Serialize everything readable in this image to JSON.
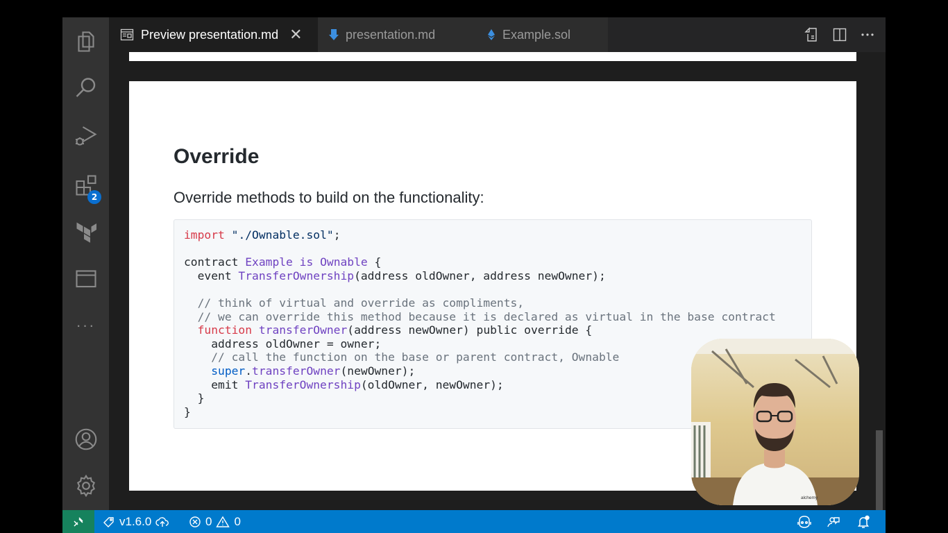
{
  "colors": {
    "activity_bar": "#333333",
    "editor_bg": "#1e1e1e",
    "status_bar": "#007acc",
    "remote_indicator": "#16825d",
    "badge": "#0a6fd0"
  },
  "activity_bar": {
    "items": [
      {
        "icon": "files-icon"
      },
      {
        "icon": "search-icon"
      },
      {
        "icon": "run-debug-icon"
      },
      {
        "icon": "extensions-icon",
        "badge": "2"
      },
      {
        "icon": "terraform-icon"
      },
      {
        "icon": "panel-icon"
      },
      {
        "icon": "more-icon",
        "label": "···"
      },
      {
        "icon": "account-icon"
      },
      {
        "icon": "gear-icon"
      }
    ]
  },
  "tabs": [
    {
      "label": "Preview presentation.md",
      "icon": "preview-icon",
      "active": true,
      "close": "✕"
    },
    {
      "label": "presentation.md",
      "icon": "markdown-icon",
      "active": false
    },
    {
      "label": "Example.sol",
      "icon": "solidity-icon",
      "active": false
    }
  ],
  "tab_actions": [
    "open-source-icon",
    "split-editor-icon",
    "more-actions-icon"
  ],
  "slide": {
    "heading": "Override",
    "text": "Override methods to build on the functionality:",
    "code": [
      [
        {
          "t": "import",
          "c": "kw"
        },
        {
          "t": " "
        },
        {
          "t": "\"./Ownable.sol\"",
          "c": "str"
        },
        {
          "t": ";"
        }
      ],
      [
        {
          "t": ""
        }
      ],
      [
        {
          "t": "contract "
        },
        {
          "t": "Example",
          "c": "ent"
        },
        {
          "t": " "
        },
        {
          "t": "is",
          "c": "ent"
        },
        {
          "t": " "
        },
        {
          "t": "Ownable",
          "c": "ent"
        },
        {
          "t": " {"
        }
      ],
      [
        {
          "t": "  event "
        },
        {
          "t": "TransferOwnership",
          "c": "ent"
        },
        {
          "t": "(address oldOwner, address newOwner);"
        }
      ],
      [
        {
          "t": ""
        }
      ],
      [
        {
          "t": "  "
        },
        {
          "t": "// think of virtual and override as compliments,",
          "c": "cm"
        }
      ],
      [
        {
          "t": "  "
        },
        {
          "t": "// we can override this method because it is declared as virtual in the base contract",
          "c": "cm"
        }
      ],
      [
        {
          "t": "  "
        },
        {
          "t": "function",
          "c": "kw"
        },
        {
          "t": " "
        },
        {
          "t": "transferOwner",
          "c": "ent"
        },
        {
          "t": "(address newOwner) public override {"
        }
      ],
      [
        {
          "t": "    address oldOwner = owner;"
        }
      ],
      [
        {
          "t": "    "
        },
        {
          "t": "// call the function on the base or parent contract, Ownable",
          "c": "cm"
        }
      ],
      [
        {
          "t": "    "
        },
        {
          "t": "super",
          "c": "bl"
        },
        {
          "t": "."
        },
        {
          "t": "transferOwner",
          "c": "ent"
        },
        {
          "t": "(newOwner);"
        }
      ],
      [
        {
          "t": "    emit "
        },
        {
          "t": "TransferOwnership",
          "c": "ent"
        },
        {
          "t": "(oldOwner, newOwner);"
        }
      ],
      [
        {
          "t": "  }"
        }
      ],
      [
        {
          "t": "}"
        }
      ]
    ]
  },
  "webcam": {
    "shirt_logo": "alchemy"
  },
  "status_bar": {
    "remote_icon": "remote-icon",
    "version": "v1.6.0",
    "errors": "0",
    "warnings": "0",
    "right_icons": [
      "copilot-icon",
      "feedback-icon",
      "notifications-icon"
    ]
  }
}
